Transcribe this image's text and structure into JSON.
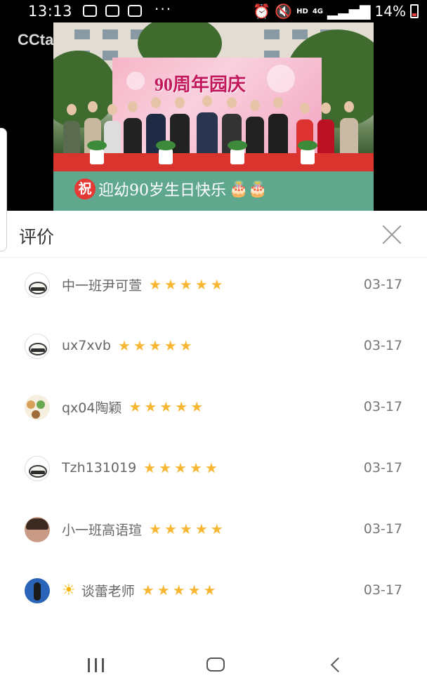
{
  "status_bar": {
    "time": "13:13",
    "more": "···",
    "hd": "HD",
    "network": "4G",
    "battery": "14%"
  },
  "video": {
    "watermark": "CCtalk",
    "banner_text": "90周年园庆",
    "caption_badge": "祝",
    "caption_text": "迎幼90岁生日快乐",
    "cakes": "🎂🎂"
  },
  "sheet": {
    "title": "评价"
  },
  "reviews": [
    {
      "name": "中一班尹可萱",
      "date": "03-17",
      "rating": 5,
      "avatar": "rabbit-avatar"
    },
    {
      "name": "ux7xvb",
      "date": "03-17",
      "rating": 5,
      "avatar": "rabbit-avatar"
    },
    {
      "name": "qx04陶颖",
      "date": "03-17",
      "rating": 5,
      "avatar": "kids-avatar"
    },
    {
      "name": "Tzh131019",
      "date": "03-17",
      "rating": 5,
      "avatar": "rabbit-avatar"
    },
    {
      "name": "小一班高语瑄",
      "date": "03-17",
      "rating": 5,
      "avatar": "child-avatar"
    },
    {
      "name": "谈蕾老师",
      "date": "03-17",
      "rating": 5,
      "avatar": "night-avatar",
      "emoji": "☀"
    }
  ],
  "colors": {
    "star": "#f7b733",
    "text_secondary": "#666666",
    "date": "#777777"
  }
}
